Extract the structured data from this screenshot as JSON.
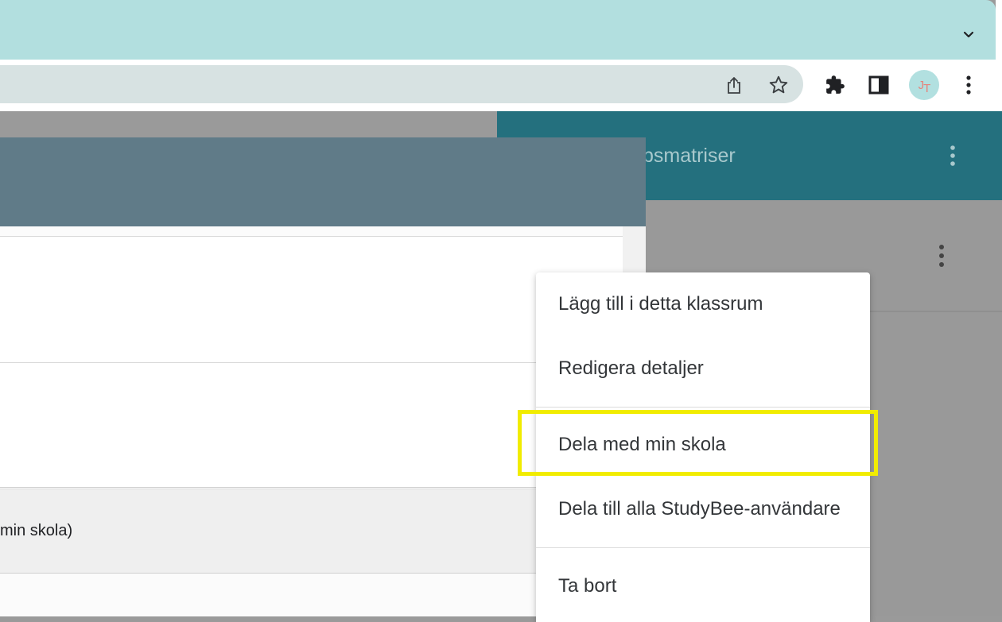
{
  "browser": {
    "tab_dropdown_icon": "chevron-down-icon",
    "toolbar_icons": [
      "share-icon",
      "bookmark-star-icon",
      "extensions-icon",
      "side-panel-icon",
      "kebab-menu-icon"
    ],
    "profile_initials": [
      "J",
      "T"
    ]
  },
  "app": {
    "header_title_fragment": "psmatriser",
    "header_color": "#24707e"
  },
  "dialog": {
    "header_color": "#607b88",
    "row3_text_fragment": "min skola)"
  },
  "context_menu": {
    "items": [
      {
        "label": "Lägg till i detta klassrum"
      },
      {
        "label": "Redigera detaljer"
      },
      {
        "label": "Dela med min skola",
        "highlighted": true
      },
      {
        "label": "Dela till alla StudyBee-användare"
      },
      {
        "label": "Ta bort"
      }
    ],
    "highlight_color": "#f1ec00"
  }
}
